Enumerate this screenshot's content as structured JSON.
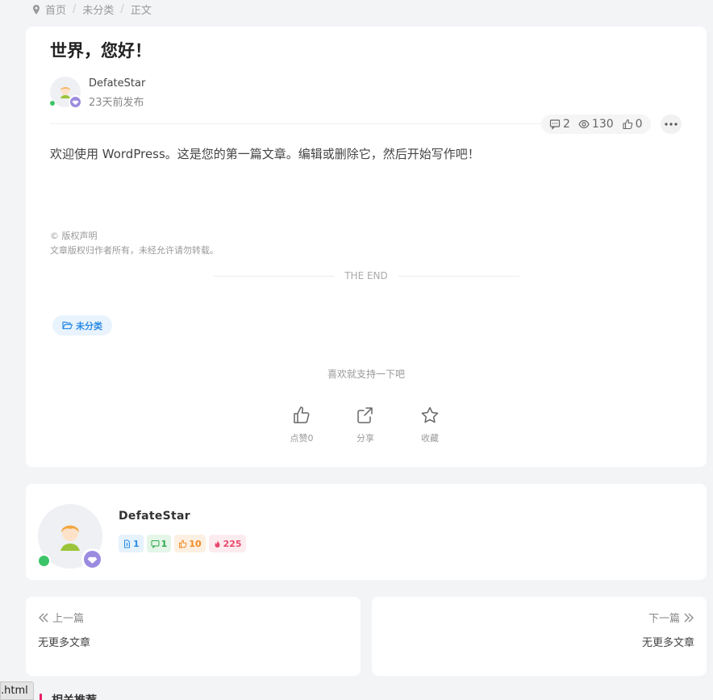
{
  "breadcrumb": {
    "home": "首页",
    "category": "未分类",
    "current": "正文",
    "icon": "map-marker-icon"
  },
  "article": {
    "title": "世界，您好！",
    "author": "DefateStar",
    "publish_time": "23天前发布",
    "comments": "2",
    "views": "130",
    "likes": "0",
    "content": "欢迎使用 WordPress。这是您的第一篇文章。编辑或删除它，然后开始写作吧！",
    "copyright_title": "© 版权声明",
    "copyright_text": "文章版权归作者所有，未经允许请勿转载。",
    "end_text": "THE END",
    "category_tag": "未分类",
    "support_text": "喜欢就支持一下吧",
    "actions": {
      "like": "点赞0",
      "share": "分享",
      "favorite": "收藏"
    }
  },
  "author_card": {
    "name": "DefateStar",
    "posts": "1",
    "comments": "1",
    "likes": "10",
    "hot": "225"
  },
  "post_nav": {
    "prev_label": "上一篇",
    "prev_value": "无更多文章",
    "next_label": "下一篇",
    "next_value": "无更多文章"
  },
  "tooltip": ".html",
  "related_title": "相关推荐",
  "colors": {
    "accent_blue": "#2d8ce4",
    "online_green": "#3cc468",
    "gem_purple": "#9b8be0",
    "related_pink": "#e91e63"
  }
}
